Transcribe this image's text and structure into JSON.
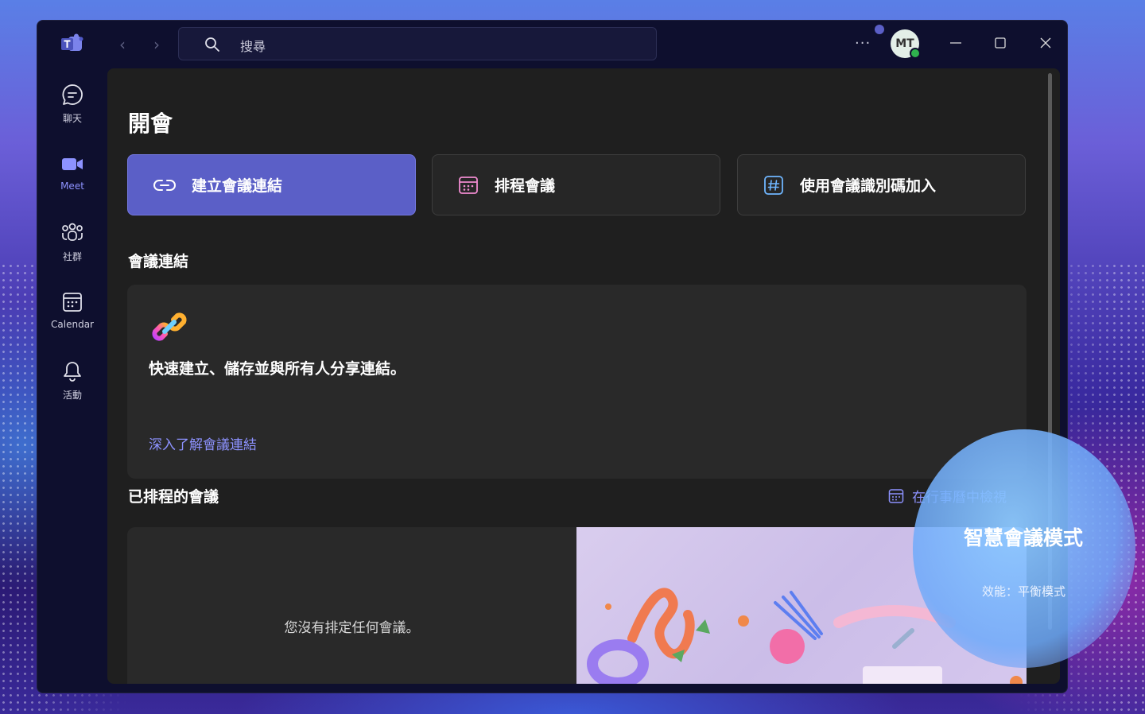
{
  "app": {
    "name": "Microsoft Teams"
  },
  "search": {
    "placeholder": "搜尋"
  },
  "profile": {
    "initials": "MT"
  },
  "rail": {
    "items": [
      {
        "label": "聊天",
        "icon": "chat-icon"
      },
      {
        "label": "Meet",
        "icon": "video-icon",
        "active": true
      },
      {
        "label": "社群",
        "icon": "community-icon"
      },
      {
        "label": "Calendar",
        "icon": "calendar-icon"
      },
      {
        "label": "活動",
        "icon": "bell-icon"
      }
    ]
  },
  "main": {
    "title": "開會",
    "actions": [
      {
        "label": "建立會議連結",
        "icon": "link-icon"
      },
      {
        "label": "排程會議",
        "icon": "calendar-icon"
      },
      {
        "label": "使用會議識別碼加入",
        "icon": "hashtag-icon"
      }
    ],
    "links_section": {
      "title": "會議連結",
      "description": "快速建立、儲存並與所有人分享連結。",
      "learn_more": "深入了解會議連結"
    },
    "scheduled_section": {
      "title": "已排程的會議",
      "calendar_link": "在行事曆中檢視",
      "empty_message": "您沒有排定任何會議。"
    }
  },
  "overlay": {
    "title": "智慧會議模式",
    "subtitle": "效能：平衡模式"
  },
  "colors": {
    "accent": "#5b5fc7",
    "link": "#8d92ff",
    "content_bg": "#1f1f1f",
    "card_bg": "#292929"
  }
}
